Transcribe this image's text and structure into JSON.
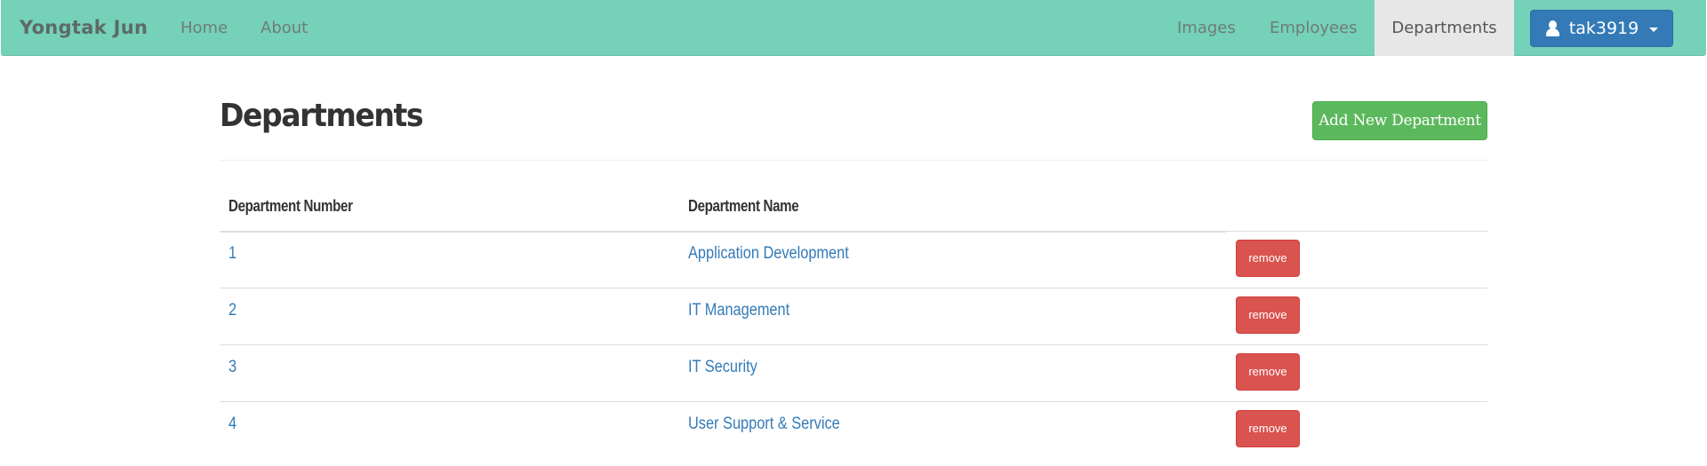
{
  "navbar": {
    "brand": "Yongtak Jun",
    "left_links": [
      "Home",
      "About"
    ],
    "right_links": [
      "Images",
      "Employees",
      "Departments"
    ],
    "active_link": "Departments",
    "user": {
      "name": "tak3919",
      "icon": "user-icon",
      "dropdown_icon": "caret-down-icon"
    }
  },
  "page": {
    "title": "Departments",
    "add_button_label": "Add New Department"
  },
  "table": {
    "columns": [
      "Department Number",
      "Department Name",
      ""
    ],
    "rows": [
      {
        "number": "1",
        "name": "Application Development",
        "action": "remove"
      },
      {
        "number": "2",
        "name": "IT Management",
        "action": "remove"
      },
      {
        "number": "3",
        "name": "IT Security",
        "action": "remove"
      },
      {
        "number": "4",
        "name": "User Support & Service",
        "action": "remove"
      }
    ]
  },
  "colors": {
    "navbar_bg": "#75d1b8",
    "active_tab_bg": "#e7e7e7",
    "primary": "#337ab7",
    "success": "#5cb85c",
    "danger": "#d9534f"
  }
}
